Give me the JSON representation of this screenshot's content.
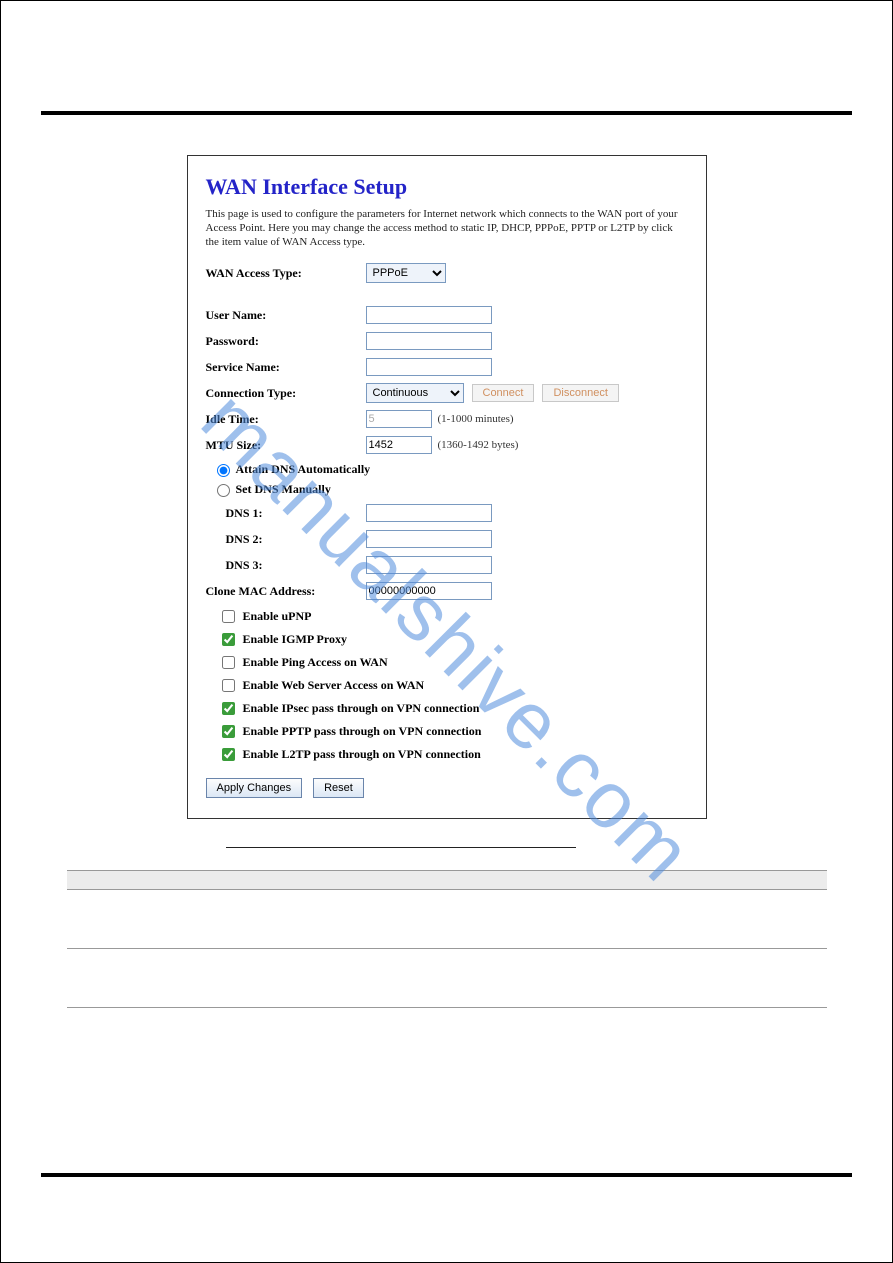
{
  "watermark": "manualshive.com",
  "title": "WAN Interface Setup",
  "description": "This page is used to configure the parameters for Internet network which connects to the WAN port of your Access Point. Here you may change the access method to static IP, DHCP, PPPoE, PPTP or L2TP by click the item value of WAN Access type.",
  "labels": {
    "wan_access_type": "WAN Access Type:",
    "user_name": "User Name:",
    "password": "Password:",
    "service_name": "Service Name:",
    "connection_type": "Connection Type:",
    "idle_time": "Idle Time:",
    "mtu_size": "MTU Size:",
    "attain_dns": "Attain DNS Automatically",
    "set_dns": "Set DNS Manually",
    "dns1": "DNS 1:",
    "dns2": "DNS 2:",
    "dns3": "DNS 3:",
    "clone_mac": "Clone MAC Address:"
  },
  "fields": {
    "wan_access_type": "PPPoE",
    "user_name": "",
    "password": "",
    "service_name": "",
    "connection_type": "Continuous",
    "idle_time": "5",
    "idle_time_hint": "(1-1000 minutes)",
    "mtu_size": "1452",
    "mtu_size_hint": "(1360-1492 bytes)",
    "dns1": "",
    "dns2": "",
    "dns3": "",
    "clone_mac": "00000000000"
  },
  "radios": {
    "dns_mode": "auto"
  },
  "buttons": {
    "connect": "Connect",
    "disconnect": "Disconnect",
    "apply": "Apply Changes",
    "reset": "Reset"
  },
  "checkboxes": [
    {
      "label": "Enable uPNP",
      "checked": false
    },
    {
      "label": "Enable IGMP Proxy",
      "checked": true
    },
    {
      "label": "Enable Ping Access on WAN",
      "checked": false
    },
    {
      "label": "Enable Web Server Access on WAN",
      "checked": false
    },
    {
      "label": "Enable IPsec pass through on VPN connection",
      "checked": true
    },
    {
      "label": "Enable PPTP pass through on VPN connection",
      "checked": true
    },
    {
      "label": "Enable L2TP pass through on VPN connection",
      "checked": true
    }
  ]
}
